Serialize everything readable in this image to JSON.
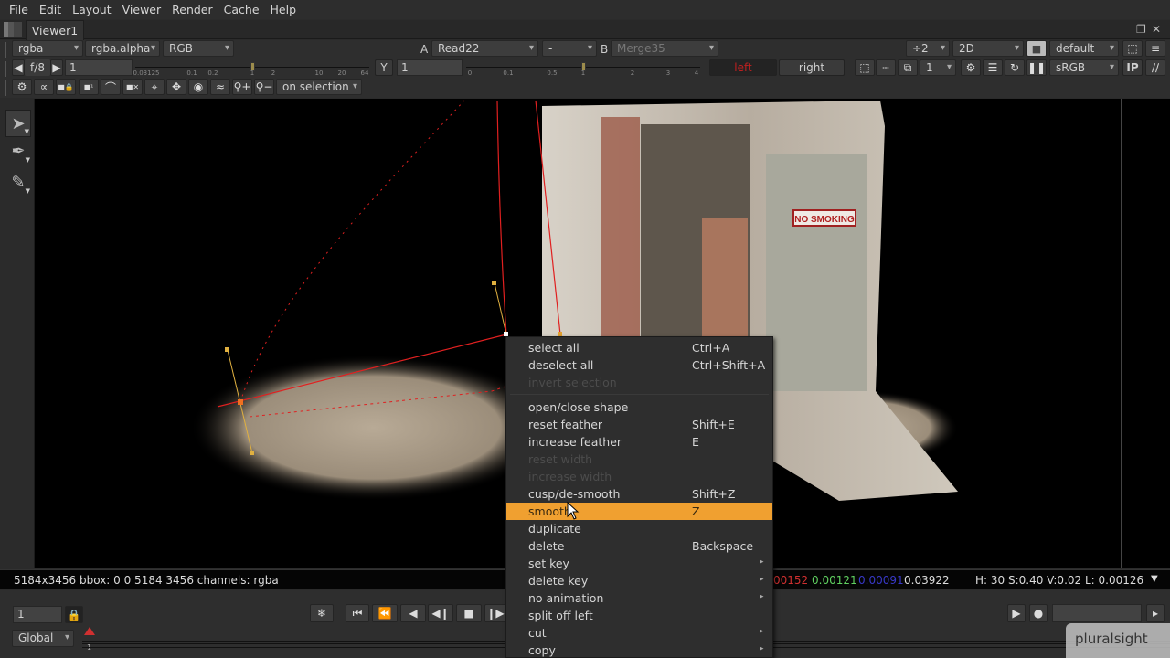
{
  "menubar": [
    "File",
    "Edit",
    "Layout",
    "Viewer",
    "Render",
    "Cache",
    "Help"
  ],
  "tab": {
    "label": "Viewer1"
  },
  "toolbar1": {
    "channels": "rgba",
    "alpha_channel": "rgba.alpha",
    "display_channel": "RGB",
    "input_a_label": "A",
    "input_a": "Read22",
    "compare_op": "-",
    "input_b_label": "B",
    "input_b": "Merge35",
    "downscale": "÷2",
    "view_mode": "2D",
    "lut_preset": "default"
  },
  "toolbar2": {
    "fstop": "f/8",
    "gain_value": "1",
    "gain_ticks": [
      "0.03125",
      "0.1",
      "0.2",
      "1",
      "2",
      "10",
      "20",
      "64"
    ],
    "gamma_label": "Y",
    "gamma_value": "1",
    "gamma_ticks": [
      "0",
      "0.1",
      "0.5",
      "1",
      "2",
      "3",
      "4"
    ],
    "stereo_left": "left",
    "stereo_right": "right",
    "proxy_value": "1",
    "colorspace": "sRGB",
    "ip_label": "IP"
  },
  "toolbar3": {
    "icons": [
      "gear-icon",
      "link-icon",
      "lock-point-icon",
      "point-1-icon",
      "curve-x-icon",
      "point-x-icon",
      "move-x-icon",
      "transform-x-icon",
      "eye-point-icon",
      "wave-icon",
      "add-key-icon",
      "remove-key-icon"
    ],
    "visibility_mode": "on selection"
  },
  "tools": [
    "select-tool",
    "pen-tool",
    "brush-tool"
  ],
  "context_menu": {
    "items": [
      {
        "label": "select all",
        "shortcut": "Ctrl+A",
        "disabled": false
      },
      {
        "label": "deselect all",
        "shortcut": "Ctrl+Shift+A",
        "disabled": false
      },
      {
        "label": "invert selection",
        "shortcut": "",
        "disabled": true
      },
      {
        "separator": true
      },
      {
        "label": "open/close shape",
        "shortcut": "",
        "disabled": false
      },
      {
        "label": "reset feather",
        "shortcut": "Shift+E",
        "disabled": false
      },
      {
        "label": "increase feather",
        "shortcut": "E",
        "disabled": false
      },
      {
        "label": "reset width",
        "shortcut": "",
        "disabled": true
      },
      {
        "label": "increase width",
        "shortcut": "",
        "disabled": true
      },
      {
        "label": "cusp/de-smooth",
        "shortcut": "Shift+Z",
        "disabled": false
      },
      {
        "label": "smooth",
        "shortcut": "Z",
        "disabled": false,
        "highlighted": true
      },
      {
        "label": "duplicate",
        "shortcut": "",
        "disabled": false
      },
      {
        "label": "delete",
        "shortcut": "Backspace",
        "disabled": false
      },
      {
        "label": "set key",
        "shortcut": "",
        "submenu": true
      },
      {
        "label": "delete key",
        "shortcut": "",
        "submenu": true
      },
      {
        "label": "no animation",
        "shortcut": "",
        "submenu": true
      },
      {
        "label": "split off left",
        "shortcut": ""
      },
      {
        "label": "cut",
        "shortcut": "",
        "submenu": true
      },
      {
        "label": "copy",
        "shortcut": "",
        "submenu": true
      }
    ]
  },
  "infobar": {
    "format": "5184x3456 bbox: 0 0 5184 3456 channels: rgba",
    "red": "00152",
    "green": "0.00121",
    "blue": "0.00091",
    "alpha": "0.03922",
    "hsvl": "H: 30 S:0.40 V:0.02  L: 0.00126",
    "colors": {
      "red": "#d03030",
      "green": "#60d060",
      "blue": "#3030c0",
      "alpha": "#e8e8e8"
    }
  },
  "timeline": {
    "frame": "1",
    "scope": "Global",
    "current_frame_marker": "1"
  },
  "viewer_image": {
    "sign_text": "NO SMOKING"
  },
  "watermark": "pluralsight",
  "colors": {
    "highlight": "#f0a030",
    "roto_curve": "#e02020",
    "roto_handle": "#e0b040"
  }
}
